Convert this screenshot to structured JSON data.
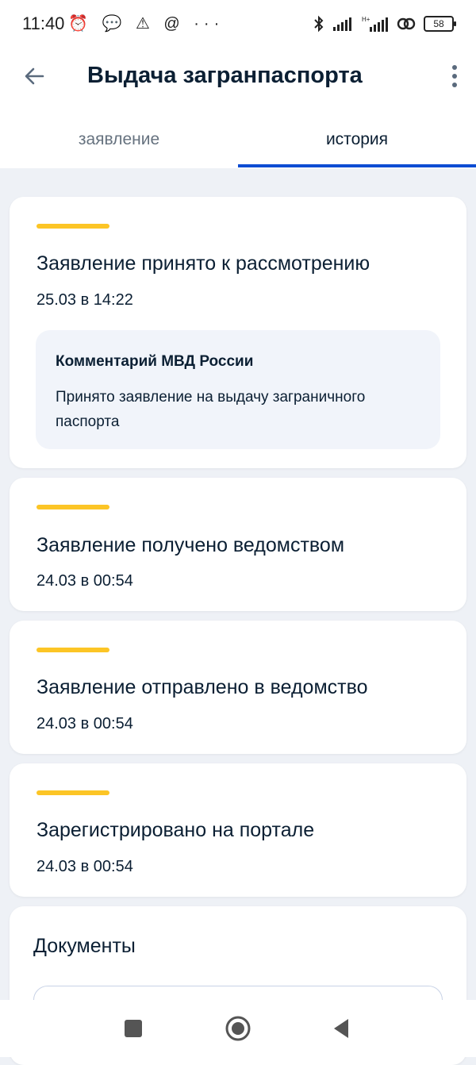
{
  "status_bar": {
    "time": "11:40",
    "left_icons": "⏰ 💬 ⚠ @ ···",
    "battery": "58"
  },
  "header": {
    "title": "Выдача загранпаспорта"
  },
  "tabs": [
    {
      "label": "заявление"
    },
    {
      "label": "история",
      "active": true
    }
  ],
  "history": [
    {
      "title": "Заявление принято к рассмотрению",
      "date": "25.03 в 14:22",
      "comment": {
        "title": "Комментарий МВД России",
        "text": "Принято заявление на выдачу заграничного паспорта"
      }
    },
    {
      "title": "Заявление получено ведомством",
      "date": "24.03 в 00:54"
    },
    {
      "title": "Заявление отправлено в ведомство",
      "date": "24.03 в 00:54"
    },
    {
      "title": "Зарегистрировано на портале",
      "date": "24.03 в 00:54"
    }
  ],
  "documents": {
    "title": "Документы"
  },
  "colors": {
    "accent_yellow": "#fcc526",
    "active_tab": "#0d4cd3",
    "background": "#eef1f6"
  }
}
